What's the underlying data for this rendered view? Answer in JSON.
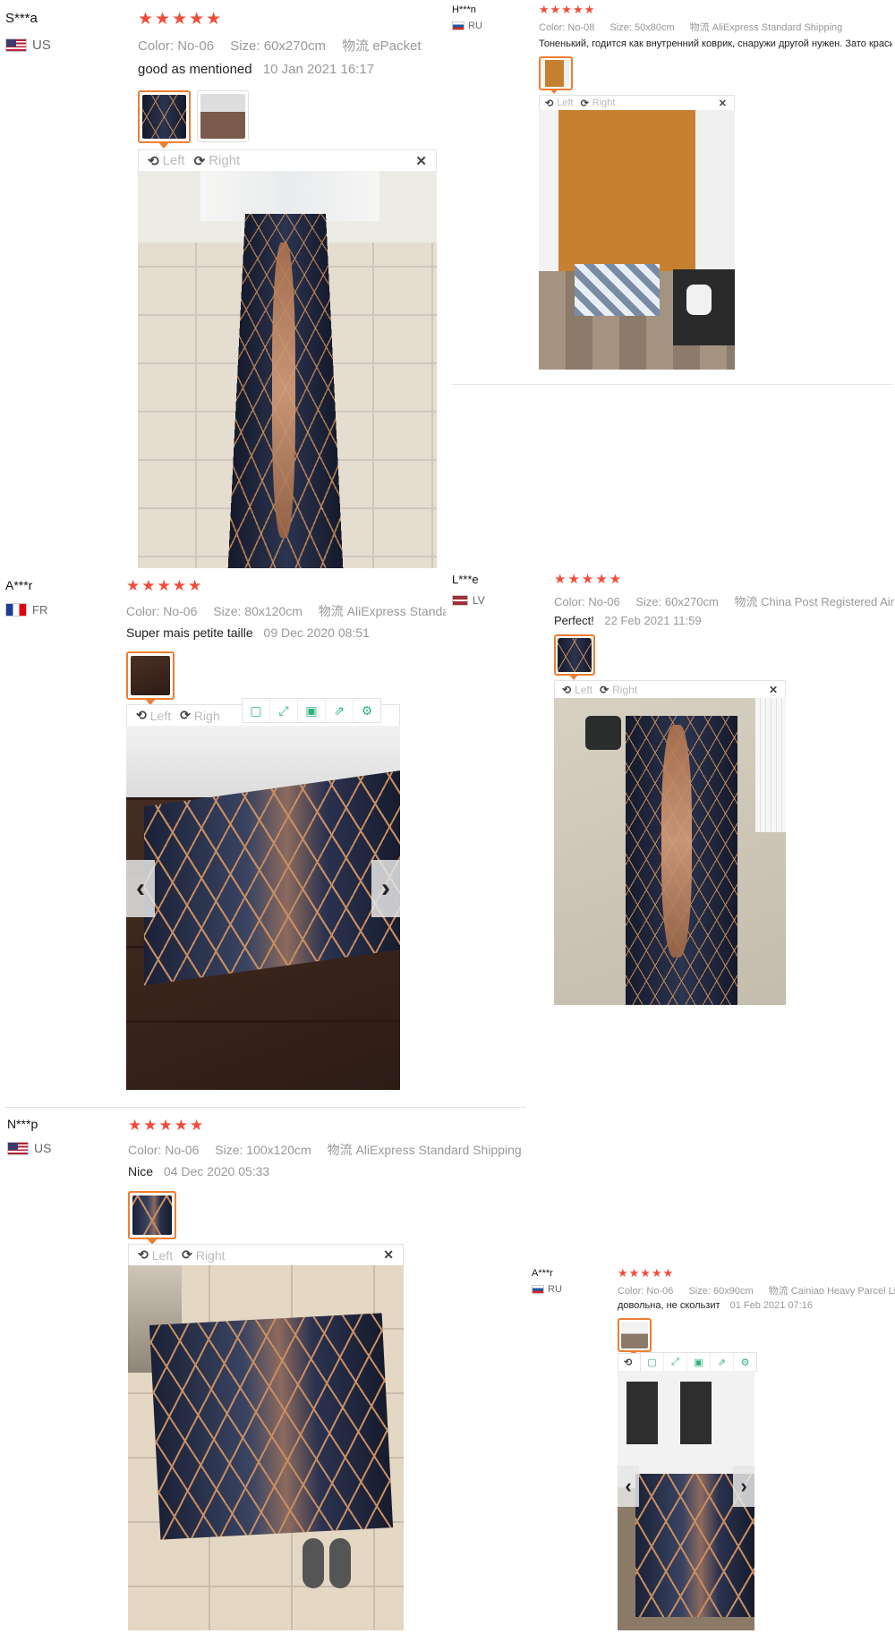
{
  "reviews": [
    {
      "user": "S***a",
      "country": "US",
      "stars": "★★★★★",
      "color_label": "Color:",
      "color": "No-06",
      "size_label": "Size:",
      "size": "60x270cm",
      "ship_label": "物流",
      "ship": "ePacket",
      "comment": "good as mentioned",
      "date": "10 Jan 2021 16:17",
      "left": "Left",
      "right": "Right"
    },
    {
      "user": "H***n",
      "country": "RU",
      "stars": "★★★★★",
      "color_label": "Color:",
      "color": "No-08",
      "size_label": "Size:",
      "size": "50x80cm",
      "ship_label": "物流",
      "ship": "AliExpress Standard Shipping",
      "comment": "Тоненький, годится как внутренний коврик, снаружи другой нужен. Зато красив",
      "left": "Left",
      "right": "Right"
    },
    {
      "user": "A***r",
      "country": "FR",
      "stars": "★★★★★",
      "color_label": "Color:",
      "color": "No-06",
      "size_label": "Size:",
      "size": "80x120cm",
      "ship_label": "物流",
      "ship": "AliExpress Standa",
      "comment": "Super mais petite taille",
      "date": "09 Dec 2020 08:51",
      "left": "Left",
      "right": "Righ"
    },
    {
      "user": "L***e",
      "country": "LV",
      "stars": "★★★★★",
      "color_label": "Color:",
      "color": "No-06",
      "size_label": "Size:",
      "size": "60x270cm",
      "ship_label": "物流",
      "ship": "China Post Registered Air Mail",
      "comment": "Perfect!",
      "date": "22 Feb 2021 11:59",
      "left": "Left",
      "right": "Right"
    },
    {
      "user": "N***p",
      "country": "US",
      "stars": "★★★★★",
      "color_label": "Color:",
      "color": "No-06",
      "size_label": "Size:",
      "size": "100x120cm",
      "ship_label": "物流",
      "ship": "AliExpress Standard Shipping",
      "comment": "Nice",
      "date": "04 Dec 2020 05:33",
      "left": "Left",
      "right": "Right"
    },
    {
      "user": "A***r",
      "country": "RU",
      "stars": "★★★★★",
      "color_label": "Color:",
      "color": "No-06",
      "size_label": "Size:",
      "size": "60x90cm",
      "ship_label": "物流",
      "ship": "Cainiao Heavy Parcel Line",
      "comment": "довольна, не скользит",
      "date": "01 Feb 2021 07:16"
    }
  ],
  "icons": {
    "rotate_left": "⟲",
    "rotate_right": "⟳",
    "close": "✕",
    "prev": "‹",
    "next": "›"
  },
  "colors": {
    "star": "#f14c3b",
    "thumb_border": "#ef7d32",
    "tool_icon": "#2db37a"
  }
}
